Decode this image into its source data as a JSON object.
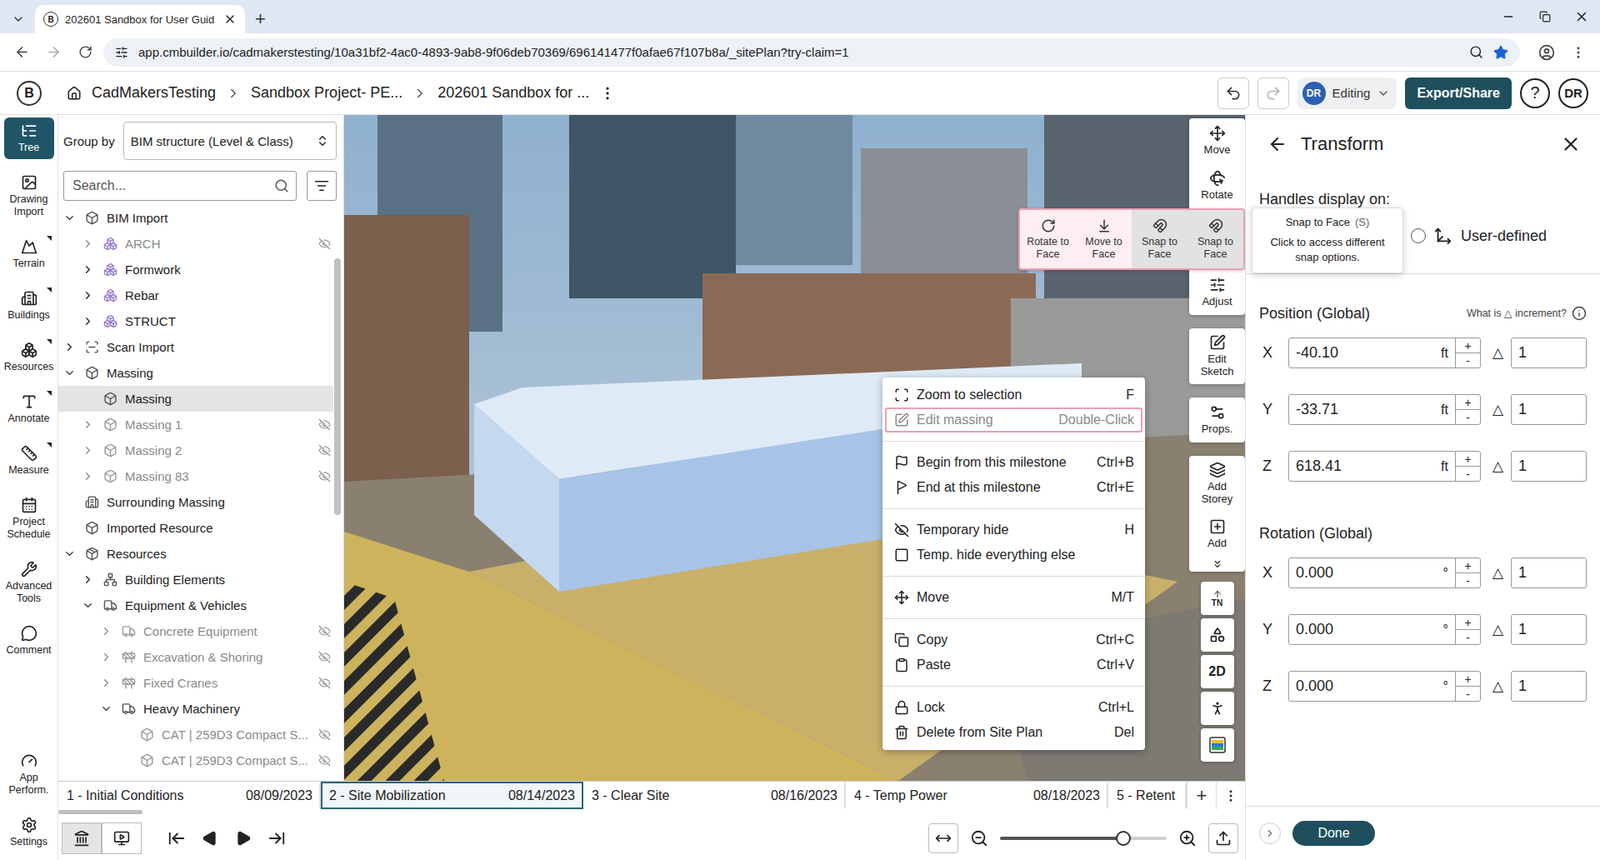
{
  "browser": {
    "favicon": "B",
    "tab_title": "202601 Sandbox for User Guid",
    "new_tab": "+",
    "url": "app.cmbuilder.io/cadmakerstesting/10a31bf2-4ac0-4893-9ab8-9f06deb70369/696141477f0afae67f107b8a/_sitePlan?try-claim=1",
    "bookmarked": true
  },
  "header": {
    "logo": "B",
    "breadcrumbs": [
      "CadMakersTesting",
      "Sandbox Project- PE...",
      "202601 Sandbox for ..."
    ],
    "mode_avatar": "DR",
    "mode": "Editing",
    "export": "Export/Share",
    "help": "?",
    "user": "DR",
    "redo_disabled": true
  },
  "rail": {
    "items": [
      {
        "label": "Tree",
        "selected": true,
        "flyout": false
      },
      {
        "label": "Drawing Import",
        "selected": false,
        "flyout": false
      },
      {
        "label": "Terrain",
        "selected": false,
        "flyout": true
      },
      {
        "label": "Buildings",
        "selected": false,
        "flyout": true
      },
      {
        "label": "Resources",
        "selected": false,
        "flyout": true
      },
      {
        "label": "Annotate",
        "selected": false,
        "flyout": true
      },
      {
        "label": "Measure",
        "selected": false,
        "flyout": true
      },
      {
        "label": "Project Schedule",
        "selected": false,
        "flyout": false
      },
      {
        "label": "Advanced Tools",
        "selected": false,
        "flyout": false
      },
      {
        "label": "Comment",
        "selected": false,
        "flyout": false
      }
    ],
    "bottom": [
      {
        "label": "App Perform."
      },
      {
        "label": "Settings"
      }
    ]
  },
  "tree": {
    "group_by_label": "Group by",
    "group_by_value": "BIM structure (Level & Class)",
    "search_placeholder": "Search...",
    "rows": [
      {
        "label": "BIM Import",
        "level": 0,
        "has_children": true,
        "expanded": true,
        "hidden": false,
        "selected": false
      },
      {
        "label": "ARCH",
        "level": 1,
        "has_children": true,
        "expanded": false,
        "hidden": true,
        "selected": false
      },
      {
        "label": "Formwork",
        "level": 1,
        "has_children": true,
        "expanded": false,
        "hidden": false,
        "selected": false
      },
      {
        "label": "Rebar",
        "level": 1,
        "has_children": true,
        "expanded": false,
        "hidden": false,
        "selected": false
      },
      {
        "label": "STRUCT",
        "level": 1,
        "has_children": true,
        "expanded": false,
        "hidden": false,
        "selected": false
      },
      {
        "label": "Scan Import",
        "level": 0,
        "has_children": true,
        "expanded": false,
        "hidden": false,
        "selected": false
      },
      {
        "label": "Massing",
        "level": 0,
        "has_children": true,
        "expanded": true,
        "hidden": false,
        "selected": false
      },
      {
        "label": "Massing",
        "level": 1,
        "has_children": false,
        "expanded": false,
        "hidden": false,
        "selected": true
      },
      {
        "label": "Massing 1",
        "level": 1,
        "has_children": true,
        "expanded": false,
        "hidden": true,
        "selected": false
      },
      {
        "label": "Massing 2",
        "level": 1,
        "has_children": true,
        "expanded": false,
        "hidden": true,
        "selected": false
      },
      {
        "label": "Massing 83",
        "level": 1,
        "has_children": true,
        "expanded": false,
        "hidden": true,
        "selected": false
      },
      {
        "label": "Surrounding Massing",
        "level": 0,
        "has_children": false,
        "expanded": false,
        "hidden": false,
        "selected": false
      },
      {
        "label": "Imported Resource",
        "level": 0,
        "has_children": false,
        "expanded": false,
        "hidden": false,
        "selected": false
      },
      {
        "label": "Resources",
        "level": 0,
        "has_children": true,
        "expanded": true,
        "hidden": false,
        "selected": false
      },
      {
        "label": "Building Elements",
        "level": 1,
        "has_children": true,
        "expanded": false,
        "hidden": false,
        "selected": false
      },
      {
        "label": "Equipment & Vehicles",
        "level": 1,
        "has_children": true,
        "expanded": true,
        "hidden": false,
        "selected": false
      },
      {
        "label": "Concrete Equipment",
        "level": 2,
        "has_children": true,
        "expanded": false,
        "hidden": true,
        "selected": false
      },
      {
        "label": "Excavation & Shoring",
        "level": 2,
        "has_children": true,
        "expanded": false,
        "hidden": true,
        "selected": false
      },
      {
        "label": "Fixed Cranes",
        "level": 2,
        "has_children": true,
        "expanded": false,
        "hidden": true,
        "selected": false
      },
      {
        "label": "Heavy Machinery",
        "level": 2,
        "has_children": true,
        "expanded": true,
        "hidden": false,
        "selected": false
      },
      {
        "label": "CAT | 259D3 Compact S...",
        "level": 3,
        "has_children": false,
        "expanded": false,
        "hidden": true,
        "selected": false
      },
      {
        "label": "CAT | 259D3 Compact S...",
        "level": 3,
        "has_children": false,
        "expanded": false,
        "hidden": true,
        "selected": false
      }
    ]
  },
  "viewport": {
    "toolbar": {
      "groups": [
        [
          {
            "kind": "tool",
            "label": "Move"
          },
          {
            "kind": "tool",
            "label": "Rotate"
          },
          {
            "kind": "snap",
            "label": "Snap to Face",
            "selected": true,
            "options": [
              {
                "label": "Rotate to Face",
                "selected": false
              },
              {
                "label": "Move to Face",
                "selected": false
              },
              {
                "label": "Snap to Face",
                "selected": true
              }
            ]
          },
          {
            "kind": "tool",
            "label": "Adjust"
          }
        ],
        [
          {
            "kind": "tool",
            "label": "Edit Sketch"
          }
        ],
        [
          {
            "kind": "tool",
            "label": "Props."
          }
        ],
        [
          {
            "kind": "tool",
            "label": "Add Storey"
          },
          {
            "kind": "tool",
            "label": "Add"
          },
          {
            "kind": "more"
          }
        ]
      ],
      "small_buttons": [
        {
          "kind": "text",
          "label": "TN"
        },
        {
          "kind": "icon"
        },
        {
          "kind": "text",
          "label": "2D"
        },
        {
          "kind": "icon"
        },
        {
          "kind": "swatch"
        }
      ]
    },
    "tooltip": {
      "title": "Snap to Face",
      "shortcut": "(S)",
      "text": "Click to access different snap options."
    },
    "context_menu": {
      "groups": [
        [
          {
            "label": "Zoom to selection",
            "shortcut": "F",
            "highlighted": false,
            "disabled": false
          },
          {
            "label": "Edit massing",
            "shortcut": "Double-Click",
            "highlighted": true,
            "disabled": true
          }
        ],
        [
          {
            "label": "Begin from this milestone",
            "shortcut": "Ctrl+B",
            "highlighted": false,
            "disabled": false
          },
          {
            "label": "End at this milestone",
            "shortcut": "Ctrl+E",
            "highlighted": false,
            "disabled": false
          }
        ],
        [
          {
            "label": "Temporary hide",
            "shortcut": "H",
            "highlighted": false,
            "disabled": false
          },
          {
            "label": "Temp. hide everything else",
            "shortcut": "",
            "highlighted": false,
            "disabled": false
          }
        ],
        [
          {
            "label": "Move",
            "shortcut": "M/T",
            "highlighted": false,
            "disabled": false
          }
        ],
        [
          {
            "label": "Copy",
            "shortcut": "Ctrl+C",
            "highlighted": false,
            "disabled": false
          },
          {
            "label": "Paste",
            "shortcut": "Ctrl+V",
            "highlighted": false,
            "disabled": false
          }
        ],
        [
          {
            "label": "Lock",
            "shortcut": "Ctrl+L",
            "highlighted": false,
            "disabled": false
          },
          {
            "label": "Delete from Site Plan",
            "shortcut": "Del",
            "highlighted": false,
            "disabled": false
          }
        ]
      ]
    }
  },
  "timeline": {
    "milestones": [
      {
        "label": "1 - Initial Conditions",
        "date": "08/09/2023",
        "selected": false
      },
      {
        "label": "2 - Site Mobilization",
        "date": "08/14/2023",
        "selected": true
      },
      {
        "label": "3 - Clear Site",
        "date": "08/16/2023",
        "selected": false
      },
      {
        "label": "4 - Temp Power",
        "date": "08/18/2023",
        "selected": false
      },
      {
        "label": "5 - Retent",
        "date": "",
        "selected": false
      }
    ],
    "add": "+"
  },
  "bottom_bar": {
    "view_toggles": [
      {
        "selected": true
      },
      {
        "selected": false
      }
    ],
    "zoom_level": 0.74
  },
  "transform": {
    "title": "Transform",
    "handles_label": "Handles display on:",
    "handle_options": [
      {
        "label": "User-defined",
        "selected": false
      }
    ],
    "delta": "△",
    "plus": "+",
    "minus": "-",
    "position": {
      "title": "Position (Global)",
      "help": "What is △ increment?",
      "rows": [
        {
          "axis": "X",
          "value": "-40.10",
          "unit": "ft",
          "increment": "1"
        },
        {
          "axis": "Y",
          "value": "-33.71",
          "unit": "ft",
          "increment": "1"
        },
        {
          "axis": "Z",
          "value": "618.41",
          "unit": "ft",
          "increment": "1"
        }
      ]
    },
    "rotation": {
      "title": "Rotation (Global)",
      "rows": [
        {
          "axis": "X",
          "value": "0.000",
          "unit": "°",
          "increment": "1"
        },
        {
          "axis": "Y",
          "value": "0.000",
          "unit": "°",
          "increment": "1"
        },
        {
          "axis": "Z",
          "value": "0.000",
          "unit": "°",
          "increment": "1"
        }
      ]
    },
    "done": "Done"
  }
}
